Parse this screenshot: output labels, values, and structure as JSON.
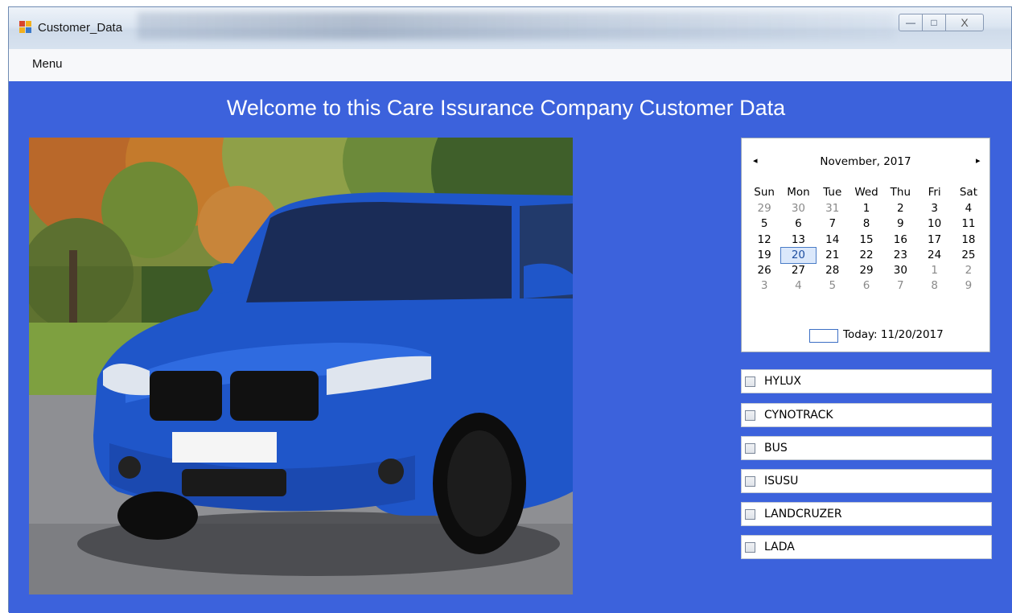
{
  "window": {
    "title": "Customer_Data",
    "controls": {
      "minimize": "—",
      "maximize": "□",
      "close": "X"
    }
  },
  "menu": {
    "items": [
      "Menu"
    ]
  },
  "main": {
    "heading": "Welcome to this Care Issurance Company Customer Data",
    "image": "blue-bmw-car-photo"
  },
  "calendar": {
    "prev": "◂",
    "next": "▸",
    "month_label": "November, 2017",
    "weekdays": [
      "Sun",
      "Mon",
      "Tue",
      "Wed",
      "Thu",
      "Fri",
      "Sat"
    ],
    "weeks": [
      [
        "29",
        "30",
        "31",
        "1",
        "2",
        "3",
        "4"
      ],
      [
        "5",
        "6",
        "7",
        "8",
        "9",
        "10",
        "11"
      ],
      [
        "12",
        "13",
        "14",
        "15",
        "16",
        "17",
        "18"
      ],
      [
        "19",
        "20",
        "21",
        "22",
        "23",
        "24",
        "25"
      ],
      [
        "26",
        "27",
        "28",
        "29",
        "30",
        "1",
        "2"
      ],
      [
        "3",
        "4",
        "5",
        "6",
        "7",
        "8",
        "9"
      ]
    ],
    "selected": "20",
    "today_label": "Today: 11/20/2017"
  },
  "options": [
    {
      "label": "HYLUX",
      "checked": false
    },
    {
      "label": "CYNOTRACK",
      "checked": false
    },
    {
      "label": "BUS",
      "checked": false
    },
    {
      "label": "ISUSU",
      "checked": false
    },
    {
      "label": "LANDCRUZER",
      "checked": false
    },
    {
      "label": "LADA",
      "checked": false
    }
  ],
  "colors": {
    "client_background": "#3c62dc",
    "heading_text": "#ffffff"
  }
}
